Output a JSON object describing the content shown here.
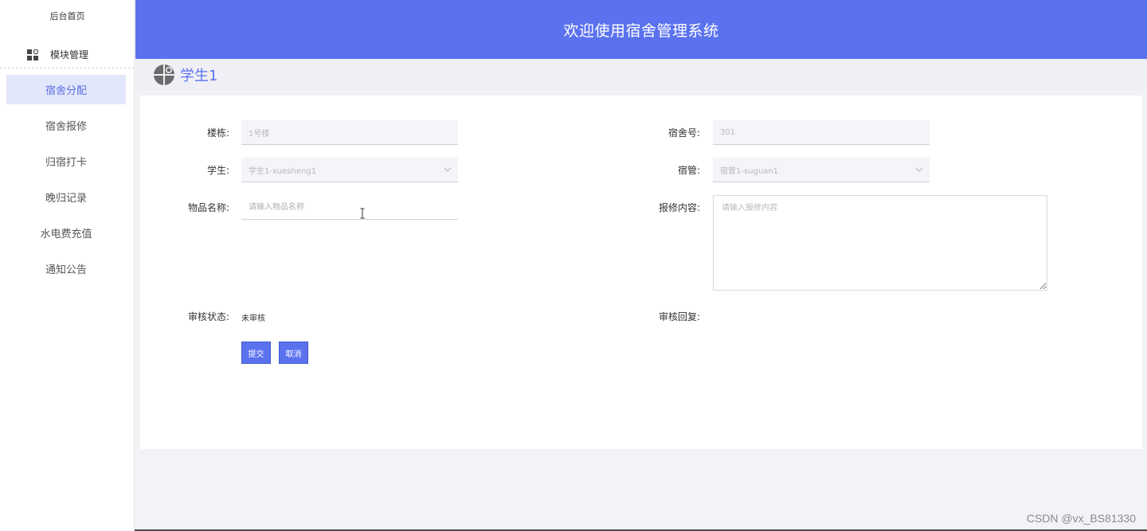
{
  "sidebar": {
    "home_label": "后台首页",
    "module_label": "模块管理",
    "items": [
      {
        "label": "宿舍分配",
        "active": true
      },
      {
        "label": "宿舍报修",
        "active": false
      },
      {
        "label": "归宿打卡",
        "active": false
      },
      {
        "label": "晚归记录",
        "active": false
      },
      {
        "label": "水电费充值",
        "active": false
      },
      {
        "label": "通知公告",
        "active": false
      }
    ]
  },
  "header": {
    "title": "欢迎使用宿舍管理系统"
  },
  "userbar": {
    "user_name": "学生1"
  },
  "form": {
    "building_label": "楼栋:",
    "building_value": "1号楼",
    "room_label": "宿舍号:",
    "room_value": "301",
    "student_label": "学生:",
    "student_value": "学生1-xuesheng1",
    "manager_label": "宿管:",
    "manager_value": "宿管1-suguan1",
    "item_label": "物品名称:",
    "item_placeholder": "请输入物品名称",
    "repair_label": "报修内容:",
    "repair_placeholder": "请输入报修内容",
    "review_status_label": "审核状态:",
    "review_status_value": "未审核",
    "review_reply_label": "审核回复:",
    "submit_label": "提交",
    "cancel_label": "取消"
  },
  "watermark": "CSDN @vx_BS81330",
  "colors": {
    "accent": "#5b72ef",
    "active_menu_bg": "#e3e7fb",
    "page_bg": "#f3f2f7"
  },
  "icons": {
    "module": "grid-apps-icon",
    "avatar": "user-avatar-icon",
    "select": "chevron-down-icon",
    "cursor": "text-cursor-icon"
  }
}
